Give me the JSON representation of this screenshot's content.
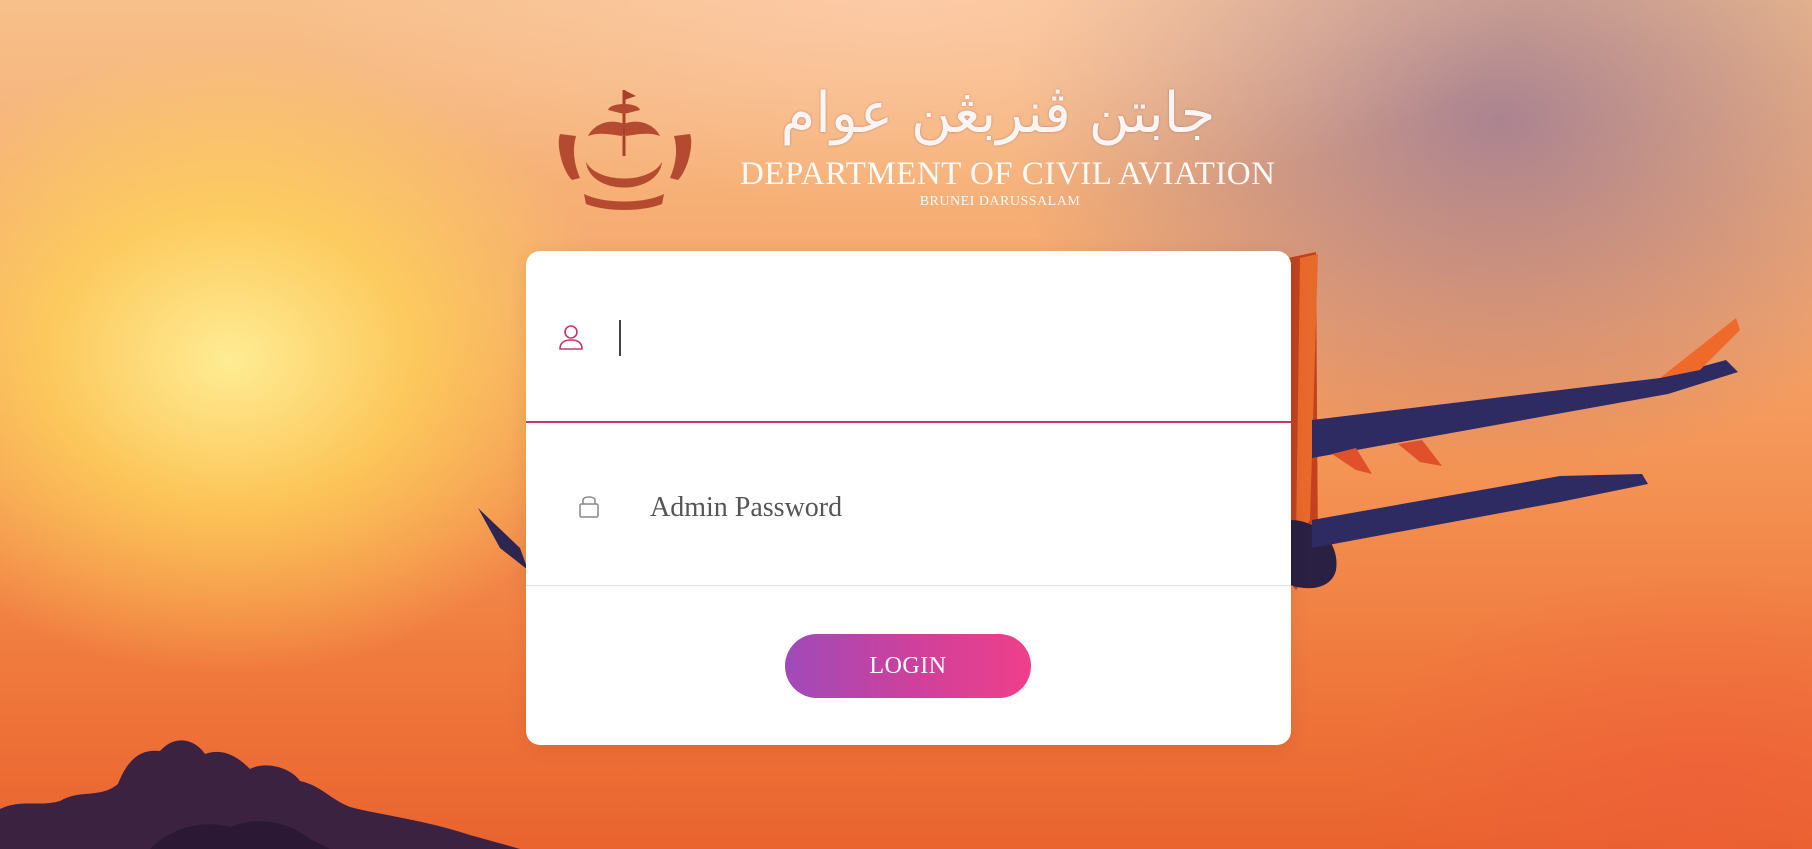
{
  "branding": {
    "jawi_title": "جابتن ڤنربڠن عوام",
    "department_name": "DEPARTMENT OF CIVIL AVIATION",
    "country": "BRUNEI DARUSSALAM"
  },
  "login_form": {
    "username": {
      "value": "",
      "placeholder": "",
      "icon": "user-icon"
    },
    "password": {
      "value": "",
      "placeholder": "Admin Password",
      "icon": "lock-icon"
    },
    "login_label": "LOGIN"
  },
  "colors": {
    "accent": "#c8336f",
    "button_gradient_start": "#9f4aba",
    "button_gradient_end": "#ef3f8a"
  }
}
